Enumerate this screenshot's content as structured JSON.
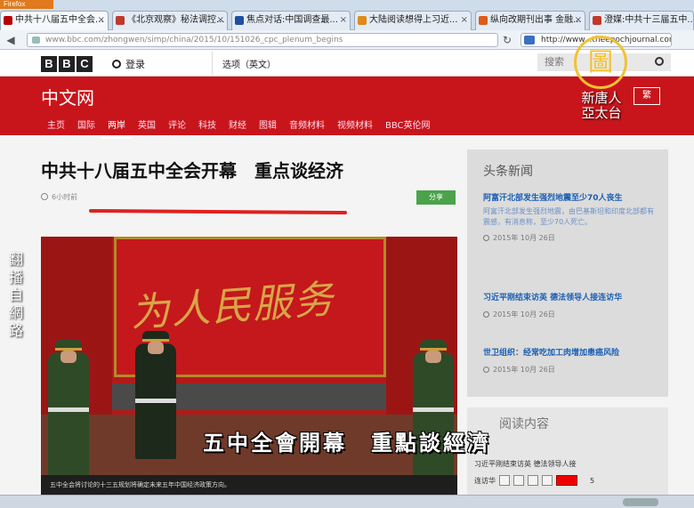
{
  "browser": {
    "menu_label": "Firefox",
    "tabs": [
      {
        "label": "中共十八届五中全会...",
        "favicon_color": "#b80000"
      },
      {
        "label": "《北京观察》秘法调控...",
        "favicon_color": "#c0392b"
      },
      {
        "label": "焦点对话:中国调查最...",
        "favicon_color": "#1f4fa3"
      },
      {
        "label": "大陆阅读想得上习近...",
        "favicon_color": "#e08a1a"
      },
      {
        "label": "纵向改期刊出事 金融...",
        "favicon_color": "#e05a1a"
      },
      {
        "label": "澄媒:中共十三届五中...",
        "favicon_color": "#c0392b"
      }
    ],
    "url": "www.bbc.com/zhongwen/simp/china/2015/10/151026_cpc_plenum_begins",
    "search_value": "http://www...theepochjournal.con"
  },
  "bbc": {
    "logo_letters": [
      "B",
      "B",
      "C"
    ],
    "login": "登录",
    "language_select": "选项（英文）",
    "search_placeholder": "搜索",
    "brand": "中文网",
    "traditional_toggle": "繁",
    "nav": [
      "主页",
      "国际",
      "两岸",
      "英国",
      "评论",
      "科技",
      "财经",
      "图辑",
      "音频材料",
      "视频材料",
      "BBC英伦网"
    ],
    "active_nav": "两岸"
  },
  "article": {
    "title": "中共十八届五中全会开幕　重点谈经济",
    "time": "6小时前",
    "share": "分享",
    "photo_slogan": "为人民服务",
    "photo_caption": "五中全会将讨论的十三五规划将确定未来五年中国经济政策方向。"
  },
  "sidebar": {
    "heading": "头条新闻",
    "items": [
      {
        "headline": "阿富汗北部发生强烈地震至少70人丧生",
        "summary": "阿富汗北部发生强烈地震，由巴基斯坦和印度北部都有震感，有消息称，至少70人死亡。",
        "date": "2015年 10月 26日"
      },
      {
        "headline": "习近平刚结束访英 德法领导人接连访华",
        "summary": "",
        "date": "2015年 10月 26日"
      },
      {
        "headline": "世卫组织：经常吃加工肉增加患癌风险",
        "summary": "",
        "date": "2015年 10月 26日"
      }
    ]
  },
  "reading": {
    "heading": "阅读内容",
    "link": "习近平刚结束访英 德法领导人接",
    "toolbar_label": "连访华",
    "stepper_value": "5"
  },
  "overlay": {
    "ntd_emblem": "圖",
    "ntd_name_line1": "新唐人",
    "ntd_name_line2": "亞太台",
    "vertical_tag": "翻播自網路",
    "subtitle": "五中全會開幕　重點談經濟"
  },
  "colors": {
    "bbc_red": "#c8151b",
    "link_blue": "#1a5fb4",
    "share_green": "#4aa34a",
    "ntd_gold": "#f1c232"
  }
}
